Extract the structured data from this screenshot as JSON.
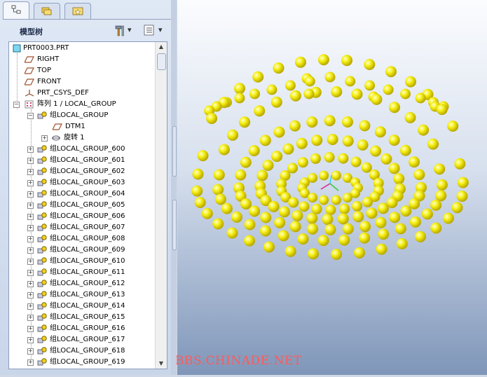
{
  "tabs": [
    {
      "name": "model-tree-tab",
      "icon": "tree-icon"
    },
    {
      "name": "layers-tab",
      "icon": "folder-stack-icon"
    },
    {
      "name": "favorites-tab",
      "icon": "favorites-folder-icon"
    }
  ],
  "header": {
    "title": "模型树",
    "tools_icon": "hammer-wrench-icon",
    "settings_icon": "list-settings-icon",
    "dropdown_glyph": "▾"
  },
  "tree": {
    "root": "PRT0003.PRT",
    "datums": [
      "RIGHT",
      "TOP",
      "FRONT"
    ],
    "csys": "PRT_CSYS_DEF",
    "pattern": "阵列 1 / LOCAL_GROUP",
    "group": "组LOCAL_GROUP",
    "dtm": "DTM1",
    "rotate": "旋转 1",
    "groups": [
      "组LOCAL_GROUP_600",
      "组LOCAL_GROUP_601",
      "组LOCAL_GROUP_602",
      "组LOCAL_GROUP_603",
      "组LOCAL_GROUP_604",
      "组LOCAL_GROUP_605",
      "组LOCAL_GROUP_606",
      "组LOCAL_GROUP_607",
      "组LOCAL_GROUP_608",
      "组LOCAL_GROUP_609",
      "组LOCAL_GROUP_610",
      "组LOCAL_GROUP_611",
      "组LOCAL_GROUP_612",
      "组LOCAL_GROUP_613",
      "组LOCAL_GROUP_614",
      "组LOCAL_GROUP_615",
      "组LOCAL_GROUP_616",
      "组LOCAL_GROUP_617",
      "组LOCAL_GROUP_618",
      "组LOCAL_GROUP_619"
    ]
  },
  "colors": {
    "sphere": "#f5ee12",
    "sphere_shade": "#b8a800",
    "csys_x": "#e0208a",
    "csys_y": "#33cc33",
    "csys_z": "#33ccee"
  },
  "watermark": "BBS.CHINADE.NET"
}
